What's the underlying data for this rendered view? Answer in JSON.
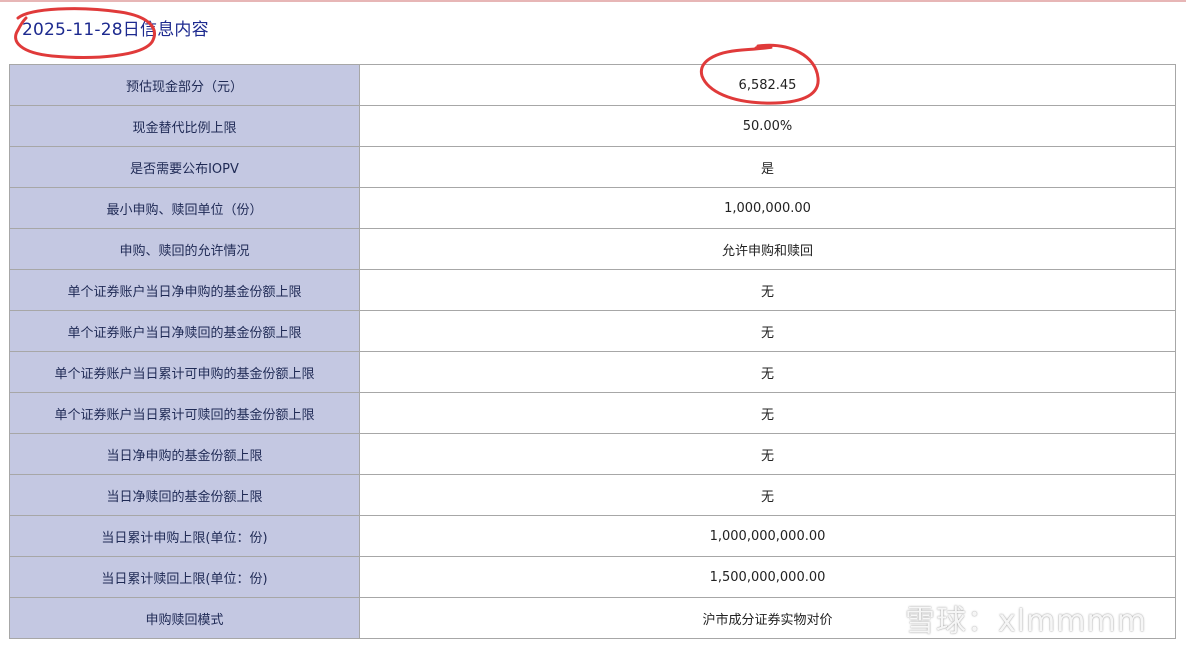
{
  "page": {
    "title": "2025-11-28日信息内容"
  },
  "rows": [
    {
      "label": "预估现金部分（元）",
      "value": "6,582.45"
    },
    {
      "label": "现金替代比例上限",
      "value": "50.00%"
    },
    {
      "label": "是否需要公布IOPV",
      "value": "是"
    },
    {
      "label": "最小申购、赎回单位（份）",
      "value": "1,000,000.00"
    },
    {
      "label": "申购、赎回的允许情况",
      "value": "允许申购和赎回"
    },
    {
      "label": "单个证券账户当日净申购的基金份额上限",
      "value": "无"
    },
    {
      "label": "单个证券账户当日净赎回的基金份额上限",
      "value": "无"
    },
    {
      "label": "单个证券账户当日累计可申购的基金份额上限",
      "value": "无"
    },
    {
      "label": "单个证券账户当日累计可赎回的基金份额上限",
      "value": "无"
    },
    {
      "label": "当日净申购的基金份额上限",
      "value": "无"
    },
    {
      "label": "当日净赎回的基金份额上限",
      "value": "无"
    },
    {
      "label": "当日累计申购上限(单位：份)",
      "value": "1,000,000,000.00"
    },
    {
      "label": "当日累计赎回上限(单位：份)",
      "value": "1,500,000,000.00"
    },
    {
      "label": "申购赎回模式",
      "value": "沪市成分证券实物对价"
    }
  ],
  "watermark": {
    "text": "雪球：xlmmmm",
    "logo_icon": "snowball-logo-icon"
  },
  "annotations": {
    "color": "#e03a3a"
  },
  "colors": {
    "title_text": "#1d2a8f",
    "label_cell_bg": "#c4c8e2",
    "border": "#a7a7a7"
  }
}
